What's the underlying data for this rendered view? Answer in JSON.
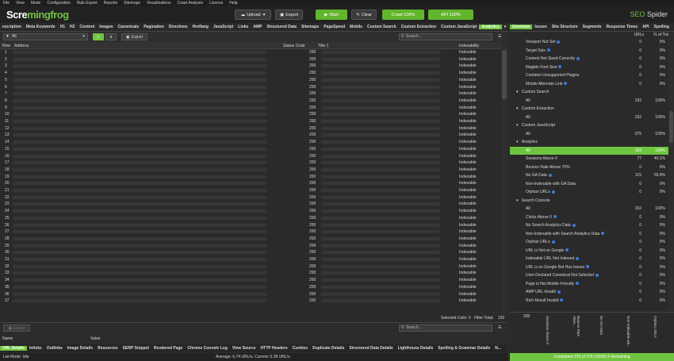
{
  "menu": [
    "File",
    "View",
    "Mode",
    "Configuration",
    "Bulk Export",
    "Reports",
    "Sitemaps",
    "Visualisations",
    "Crawl Analysis",
    "Licence",
    "Help"
  ],
  "logo": {
    "part1": "Scre",
    "part2": "mingfrog"
  },
  "toolbar": {
    "upload": "Upload",
    "export": "Export",
    "start": "Start",
    "clear": "Clear",
    "crawl_status": "Crawl 100%",
    "api_status": "API 100%"
  },
  "brand": {
    "seo": "SEO",
    "spider": "Spider"
  },
  "tabs": [
    "escription",
    "Meta Keywords",
    "H1",
    "H2",
    "Content",
    "Images",
    "Canonicals",
    "Pagination",
    "Directives",
    "Hreflang",
    "JavaScript",
    "Links",
    "AMP",
    "Structured Data",
    "Sitemaps",
    "PageSpeed",
    "Mobile",
    "Custom Search",
    "Custom Extraction",
    "Custom JavaScript",
    "Analytics"
  ],
  "active_tab": "Analytics",
  "filter": {
    "selected": "All",
    "export": "Export",
    "search_placeholder": "Search..."
  },
  "columns": {
    "row": "Row",
    "address": "Address",
    "status": "Status Code",
    "title": "Title 1",
    "indexability": "Indexability"
  },
  "rows": [
    {
      "n": "1",
      "s": "200",
      "i": "Indexable"
    },
    {
      "n": "2",
      "s": "200",
      "i": "Indexable"
    },
    {
      "n": "3",
      "s": "200",
      "i": "Indexable"
    },
    {
      "n": "4",
      "s": "200",
      "i": "Indexable"
    },
    {
      "n": "5",
      "s": "200",
      "i": "Indexable"
    },
    {
      "n": "6",
      "s": "200",
      "i": "Indexable"
    },
    {
      "n": "7",
      "s": "200",
      "i": "Indexable"
    },
    {
      "n": "8",
      "s": "200",
      "i": "Indexable"
    },
    {
      "n": "9",
      "s": "200",
      "i": "Indexable"
    },
    {
      "n": "10",
      "s": "200",
      "i": "Indexable"
    },
    {
      "n": "11",
      "s": "200",
      "i": "Indexable"
    },
    {
      "n": "12",
      "s": "200",
      "i": "Indexable"
    },
    {
      "n": "13",
      "s": "200",
      "i": "Indexable"
    },
    {
      "n": "14",
      "s": "200",
      "i": "Indexable"
    },
    {
      "n": "15",
      "s": "200",
      "i": "Indexable"
    },
    {
      "n": "16",
      "s": "200",
      "i": "Indexable"
    },
    {
      "n": "17",
      "s": "200",
      "i": "Indexable"
    },
    {
      "n": "18",
      "s": "200",
      "i": "Indexable"
    },
    {
      "n": "19",
      "s": "200",
      "i": "Indexable"
    },
    {
      "n": "20",
      "s": "200",
      "i": "Indexable"
    },
    {
      "n": "21",
      "s": "200",
      "i": "Indexable"
    },
    {
      "n": "22",
      "s": "200",
      "i": "Indexable"
    },
    {
      "n": "23",
      "s": "200",
      "i": "Indexable"
    },
    {
      "n": "24",
      "s": "200",
      "i": "Indexable"
    },
    {
      "n": "25",
      "s": "200",
      "i": "Indexable"
    },
    {
      "n": "26",
      "s": "200",
      "i": "Indexable"
    },
    {
      "n": "27",
      "s": "200",
      "i": "Indexable"
    },
    {
      "n": "28",
      "s": "200",
      "i": "Indexable"
    },
    {
      "n": "29",
      "s": "200",
      "i": "Indexable"
    },
    {
      "n": "30",
      "s": "200",
      "i": "Indexable"
    },
    {
      "n": "31",
      "s": "200",
      "i": "Indexable"
    },
    {
      "n": "32",
      "s": "200",
      "i": "Indexable"
    },
    {
      "n": "33",
      "s": "200",
      "i": "Indexable"
    },
    {
      "n": "34",
      "s": "200",
      "i": "Indexable"
    },
    {
      "n": "35",
      "s": "200",
      "i": "Indexable"
    },
    {
      "n": "36",
      "s": "200",
      "i": "Indexable"
    },
    {
      "n": "37",
      "s": "200",
      "i": "Indexable"
    }
  ],
  "status": {
    "selected": "Selected Cells: 0",
    "filter_total": "Filter Total:",
    "filter_total_value": "192"
  },
  "lower": {
    "export": "Export",
    "search_placeholder": "Search...",
    "col_name": "Name",
    "col_value": "Value"
  },
  "lower_tabs": [
    "URL Details",
    "Inlinks",
    "Outlinks",
    "Image Details",
    "Resources",
    "SERP Snippet",
    "Rendered Page",
    "Chrome Console Log",
    "View Source",
    "HTTP Headers",
    "Cookies",
    "Duplicate Details",
    "Structured Data Details",
    "Lighthouse Details",
    "Spelling & Grammar Details",
    "N..."
  ],
  "bottom": {
    "mode": "List Mode: Idle",
    "average": "Average: 6.74 URL/s. Current: 0.28 URL/s."
  },
  "right_tabs": [
    "Overview",
    "Issues",
    "Site Structure",
    "Segments",
    "Response Times",
    "API",
    "Spelling"
  ],
  "right_cols": {
    "urls": "URLs",
    "pct": "% of Total"
  },
  "right_items": [
    {
      "t": "sub",
      "l": "Viewport Not Set",
      "u": "0",
      "p": "0%",
      "info": true
    },
    {
      "t": "sub",
      "l": "Target Size",
      "u": "0",
      "p": "0%",
      "info": true
    },
    {
      "t": "sub",
      "l": "Content Not Sized Correctly",
      "u": "0",
      "p": "0%",
      "info": true
    },
    {
      "t": "sub",
      "l": "Illegible Font Size",
      "u": "0",
      "p": "0%",
      "info": true
    },
    {
      "t": "sub",
      "l": "Contains Unsupported Plugins",
      "u": "0",
      "p": "0%",
      "info": false
    },
    {
      "t": "sub",
      "l": "Mobile Alternate Link",
      "u": "0",
      "p": "0%",
      "info": true
    },
    {
      "t": "sec",
      "l": "Custom Search",
      "u": "",
      "p": ""
    },
    {
      "t": "sub",
      "l": "All",
      "u": "192",
      "p": "100%"
    },
    {
      "t": "sec",
      "l": "Custom Extraction",
      "u": "",
      "p": ""
    },
    {
      "t": "sub",
      "l": "All",
      "u": "192",
      "p": "100%"
    },
    {
      "t": "sec",
      "l": "Custom JavaScript",
      "u": "",
      "p": ""
    },
    {
      "t": "sub",
      "l": "All",
      "u": "375",
      "p": "100%"
    },
    {
      "t": "sec",
      "l": "Analytics",
      "u": "",
      "p": ""
    },
    {
      "t": "sub",
      "l": "All",
      "u": "192",
      "p": "100%",
      "hl": true
    },
    {
      "t": "sub",
      "l": "Sessions Above 0",
      "u": "77",
      "p": "40.1%"
    },
    {
      "t": "sub",
      "l": "Bounce Rate Above 70%",
      "u": "0",
      "p": "0%"
    },
    {
      "t": "sub",
      "l": "No GA Data",
      "u": "115",
      "p": "59.9%",
      "info": true
    },
    {
      "t": "sub",
      "l": "Non-Indexable with GA Data",
      "u": "0",
      "p": "0%"
    },
    {
      "t": "sub",
      "l": "Orphan URLs",
      "u": "0",
      "p": "0%",
      "info": true
    },
    {
      "t": "sec",
      "l": "Search Console",
      "u": "",
      "p": ""
    },
    {
      "t": "sub",
      "l": "All",
      "u": "192",
      "p": "100%"
    },
    {
      "t": "sub",
      "l": "Clicks Above 0",
      "u": "0",
      "p": "0%",
      "info": true
    },
    {
      "t": "sub",
      "l": "No Search Analytics Data",
      "u": "0",
      "p": "0%",
      "info": true
    },
    {
      "t": "sub",
      "l": "Non-Indexable with Search Analytics Data",
      "u": "0",
      "p": "0%",
      "info": true
    },
    {
      "t": "sub",
      "l": "Orphan URLs",
      "u": "0",
      "p": "0%",
      "info": true
    },
    {
      "t": "sub",
      "l": "URL is Not on Google",
      "u": "0",
      "p": "0%",
      "info": true
    },
    {
      "t": "sub",
      "l": "Indexable URL Not Indexed",
      "u": "0",
      "p": "0%",
      "info": true
    },
    {
      "t": "sub",
      "l": "URL is on Google But Has Issues",
      "u": "0",
      "p": "0%",
      "info": true
    },
    {
      "t": "sub",
      "l": "User-Declared Canonical Not Selected",
      "u": "0",
      "p": "0%",
      "info": true
    },
    {
      "t": "sub",
      "l": "Page is Not Mobile Friendly",
      "u": "0",
      "p": "0%",
      "info": true
    },
    {
      "t": "sub",
      "l": "AMP URL Invalid",
      "u": "0",
      "p": "0%",
      "info": true
    },
    {
      "t": "sub",
      "l": "Rich Result Invalid",
      "u": "0",
      "p": "0%",
      "info": true
    }
  ],
  "chart": {
    "value": "200",
    "labels": [
      "Sessions Above 0",
      "Bounce Rate Abov...",
      "No GA Data",
      "Non-Indexable wit...",
      "Orphan URLs"
    ]
  },
  "progress": "Completed 375 of 375 (100%) 0 Remaining"
}
